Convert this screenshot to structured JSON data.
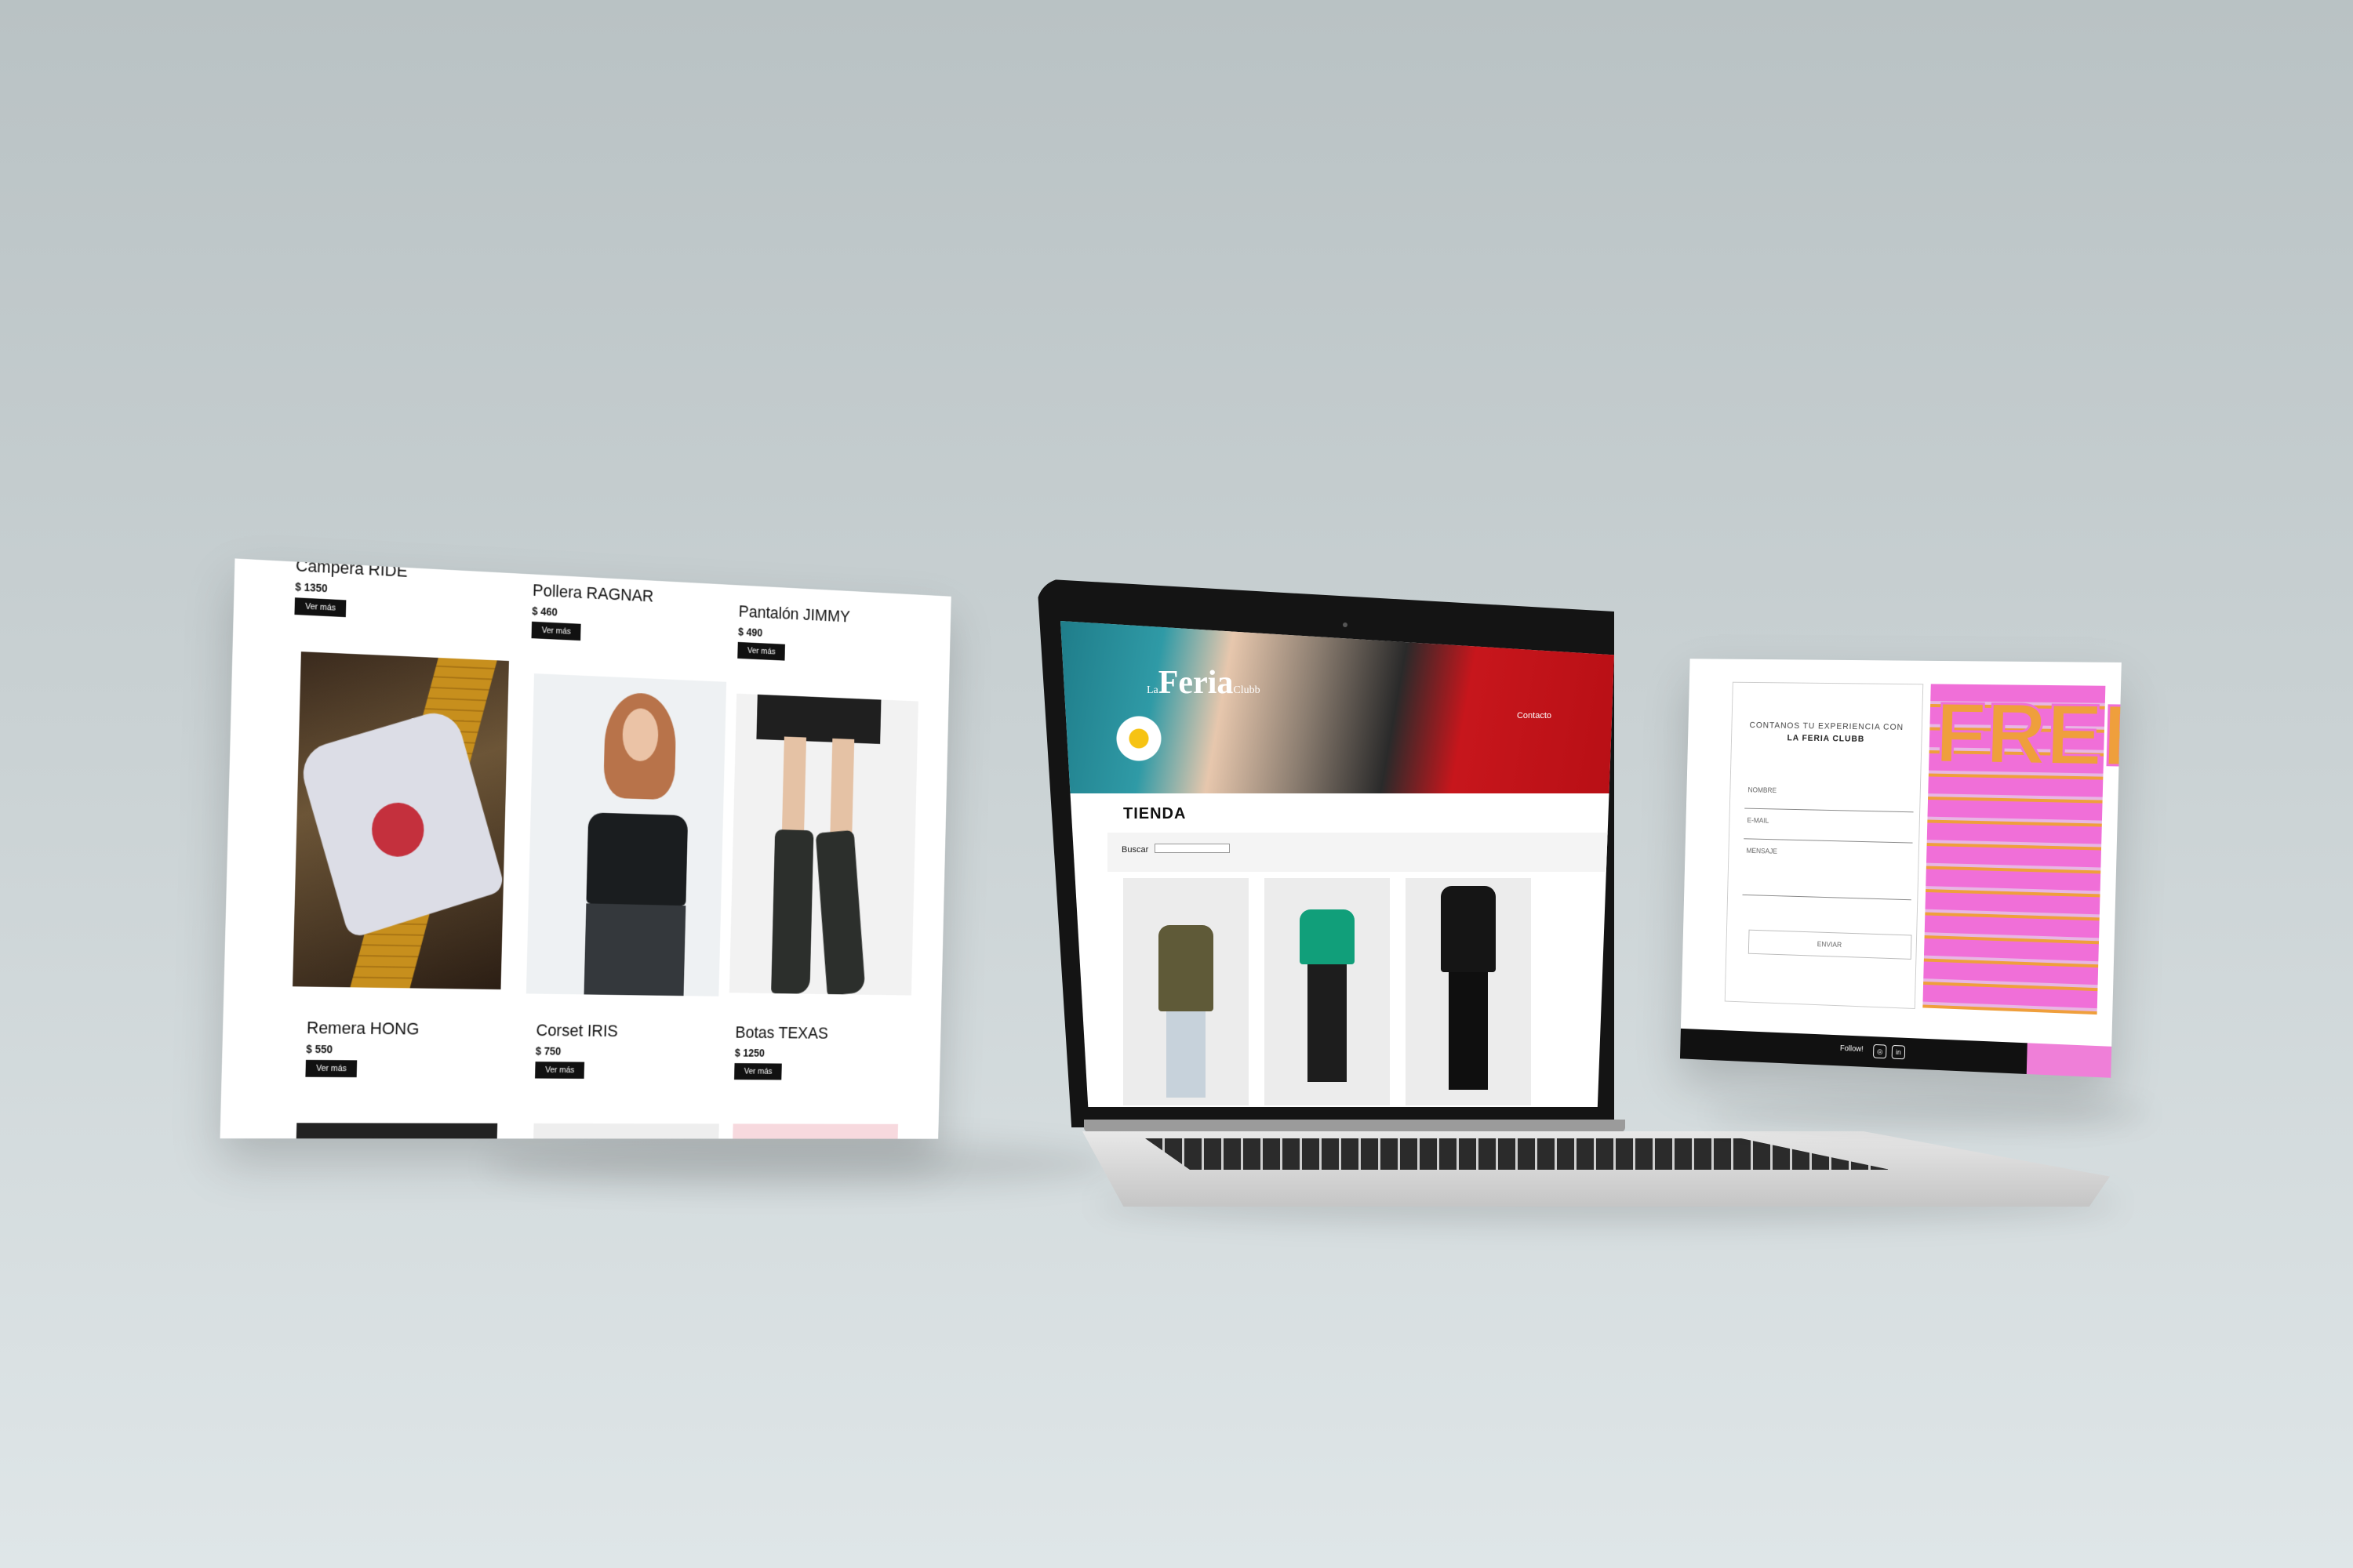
{
  "left_screen": {
    "top_row": [
      {
        "name": "Campera RIDE",
        "price": "$ 1350",
        "button": "Ver más"
      },
      {
        "name": "Pollera RAGNAR",
        "price": "$ 460",
        "button": "Ver más"
      },
      {
        "name": "Pantalón JIMMY",
        "price": "$ 490",
        "button": "Ver más"
      }
    ],
    "products": [
      {
        "name": "Remera HONG",
        "price": "$ 550",
        "button": "Ver más"
      },
      {
        "name": "Corset IRIS",
        "price": "$ 750",
        "button": "Ver más"
      },
      {
        "name": "Botas TEXAS",
        "price": "$ 1250",
        "button": "Ver más"
      }
    ]
  },
  "laptop_screen": {
    "logo": "Feria",
    "logo_prefix": "La",
    "logo_suffix": "Clubb",
    "nav_contact": "Contacto",
    "section_title": "TIENDA",
    "search_label": "Buscar",
    "search_value": ""
  },
  "right_screen": {
    "form_title": "CONTANOS TU EXPERIENCIA CON",
    "form_subtitle": "LA FERIA CLUBB",
    "field_name": "NOMBRE",
    "field_email": "E-MAIL",
    "field_message": "MENSAJE",
    "send_button": "ENVIAR",
    "art_text": "FREE",
    "footer_follow": "Follow!",
    "footer_icons": [
      "instagram-icon",
      "linkedin-icon"
    ],
    "accent_pink": "#ef7fd8"
  }
}
